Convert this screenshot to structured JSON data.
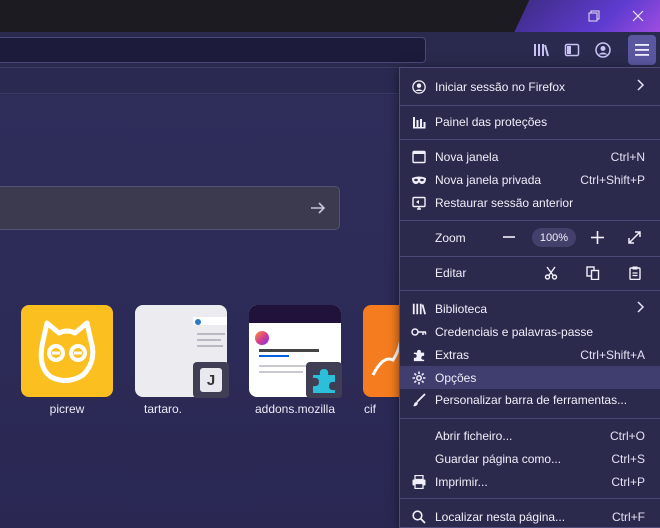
{
  "window": {
    "controls": [
      "restore",
      "close"
    ]
  },
  "navbar": {
    "icons": [
      "library-icon",
      "sidebar-icon",
      "account-icon",
      "menu-icon"
    ]
  },
  "topsites": [
    {
      "label": "picrew",
      "bg": "#fbbf1f"
    },
    {
      "label": "tartaro.",
      "bg": "#ececf0"
    },
    {
      "label": "addons.mozilla",
      "bg": "#ffffff"
    },
    {
      "label": "cif",
      "bg": "#f57c1f"
    }
  ],
  "menu": {
    "sign_in": "Iniciar sessão no Firefox",
    "protections": "Painel das proteções",
    "new_window": {
      "label": "Nova janela",
      "shortcut": "Ctrl+N"
    },
    "new_private": {
      "label": "Nova janela privada",
      "shortcut": "Ctrl+Shift+P"
    },
    "restore": "Restaurar sessão anterior",
    "zoom": {
      "label": "Zoom",
      "value": "100%"
    },
    "edit": "Editar",
    "library": "Biblioteca",
    "logins": "Credenciais e palavras-passe",
    "addons": {
      "label": "Extras",
      "shortcut": "Ctrl+Shift+A"
    },
    "options": "Opções",
    "customize": "Personalizar barra de ferramentas...",
    "open_file": {
      "label": "Abrir ficheiro...",
      "shortcut": "Ctrl+O"
    },
    "save_page": {
      "label": "Guardar página como...",
      "shortcut": "Ctrl+S"
    },
    "print": {
      "label": "Imprimir...",
      "shortcut": "Ctrl+P"
    },
    "find": {
      "label": "Localizar nesta página...",
      "shortcut": "Ctrl+F"
    }
  },
  "colors": {
    "accent": "#5a57a0",
    "panel_bg": "#2c2a4c",
    "highlight": "#403e6e"
  }
}
